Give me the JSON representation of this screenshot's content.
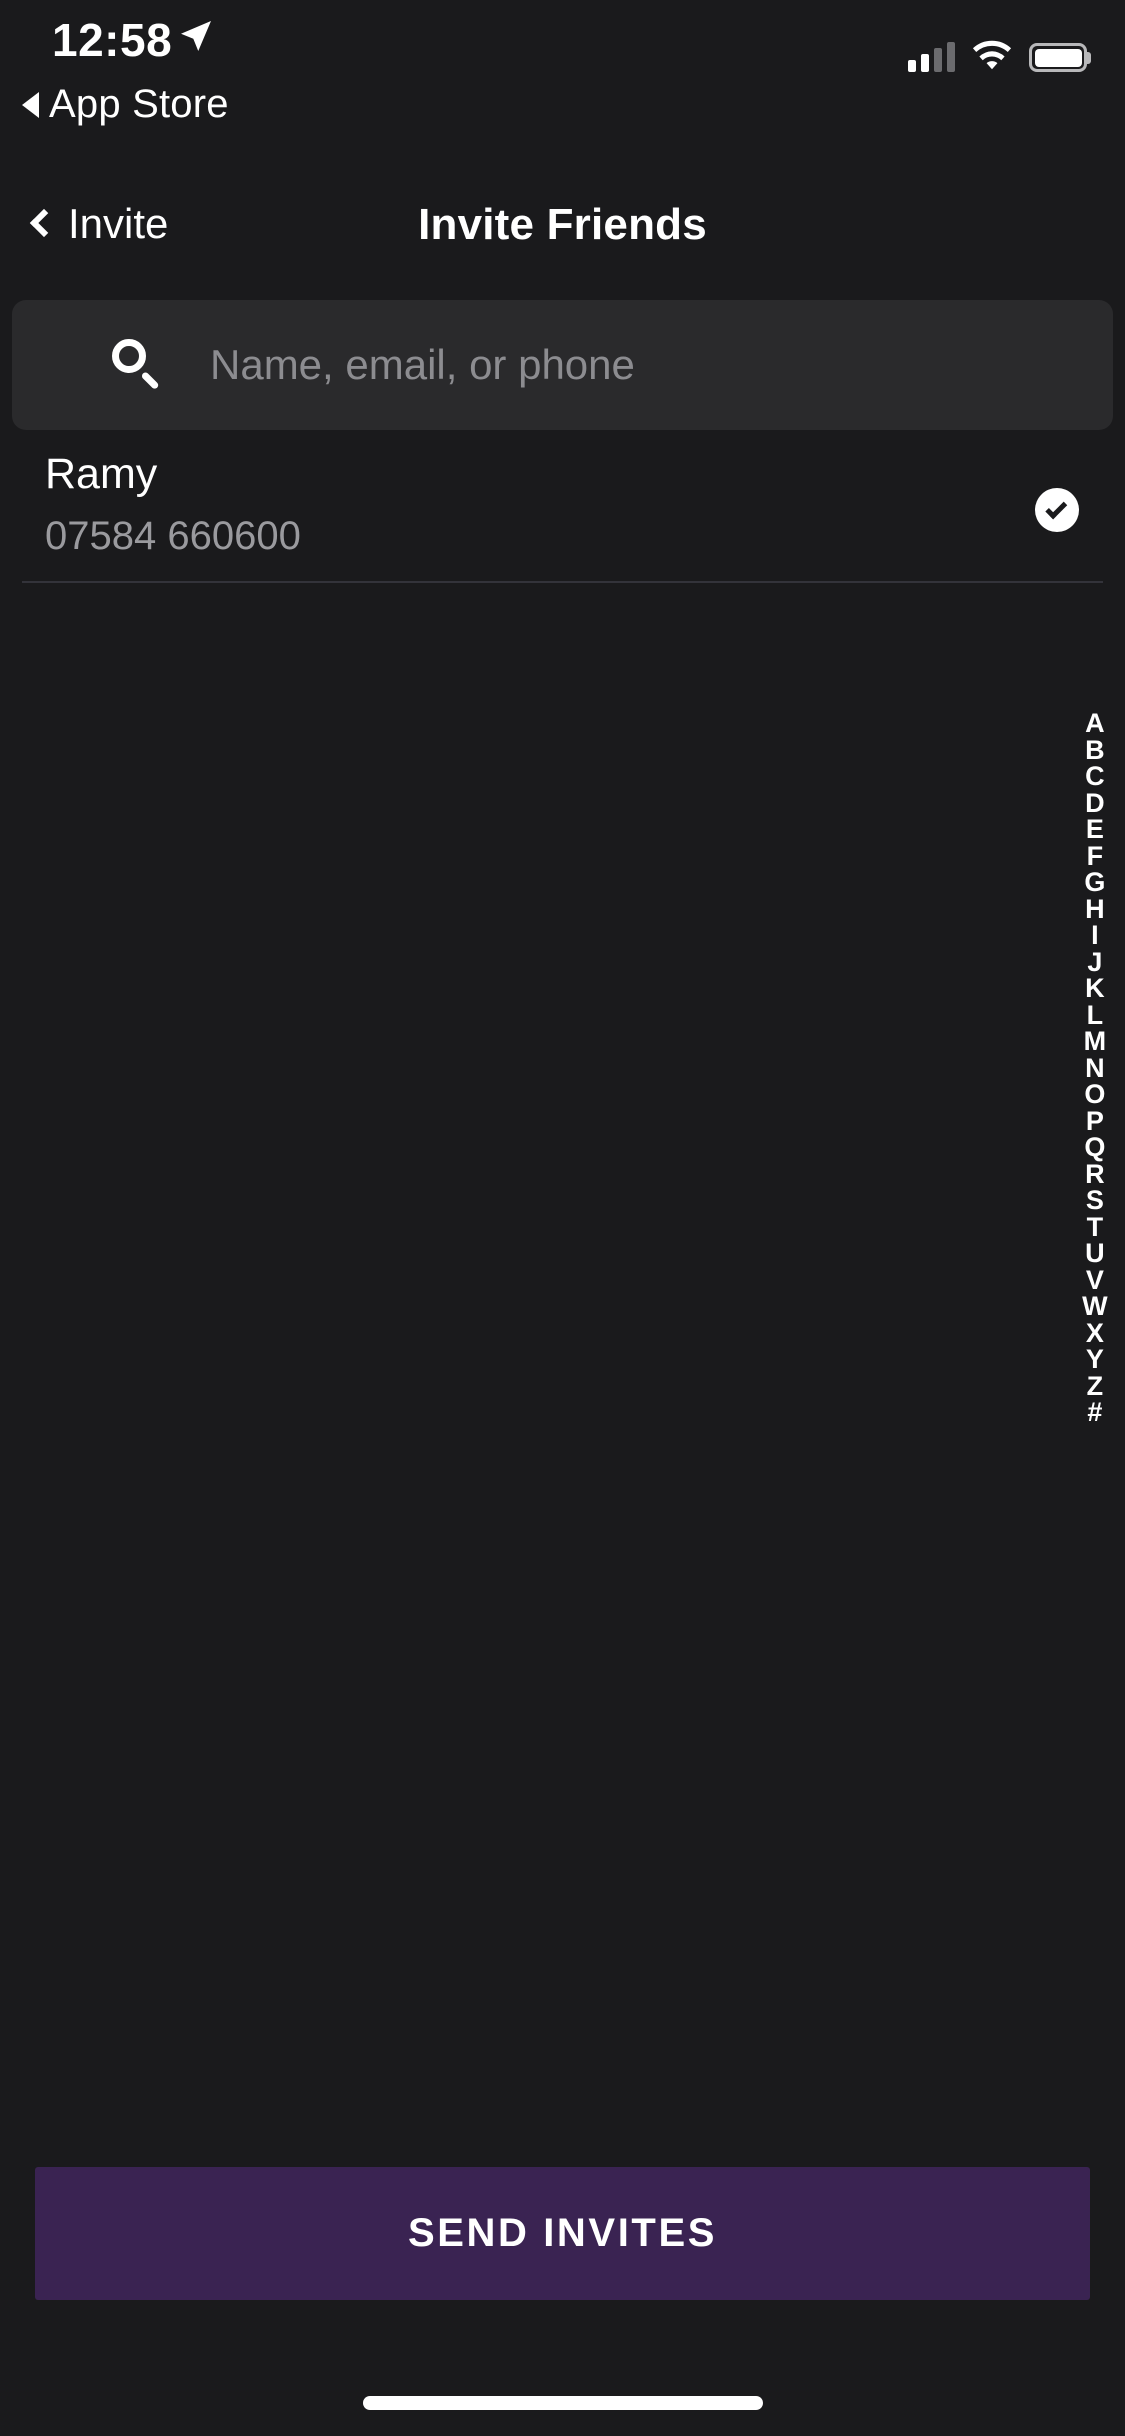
{
  "status_bar": {
    "time": "12:58",
    "location_icon": "location-arrow-icon",
    "back_to_app_label": "App Store",
    "back_to_app_icon": "triangle-left-icon",
    "signal_icon": "cellular-signal-icon",
    "signal_bars_active": 2,
    "signal_bars_total": 4,
    "wifi_icon": "wifi-icon",
    "battery_icon": "battery-full-icon"
  },
  "nav_bar": {
    "back_icon": "chevron-left-icon",
    "back_label": "Invite",
    "title": "Invite Friends"
  },
  "search": {
    "icon": "search-icon",
    "placeholder": "Name, email, or phone",
    "value": ""
  },
  "contacts": [
    {
      "name": "Ramy",
      "phone": "07584 660600",
      "selected": true,
      "select_icon": "check-circle-icon"
    }
  ],
  "alphabet_index": [
    "A",
    "B",
    "C",
    "D",
    "E",
    "F",
    "G",
    "H",
    "I",
    "J",
    "K",
    "L",
    "M",
    "N",
    "O",
    "P",
    "Q",
    "R",
    "S",
    "T",
    "U",
    "V",
    "W",
    "X",
    "Y",
    "Z",
    "#"
  ],
  "footer": {
    "send_button_label": "SEND INVITES"
  },
  "home_indicator": "home-indicator",
  "colors": {
    "background": "#1a1a1c",
    "search_field": "#2a2a2c",
    "accent_purple": "#3a2352",
    "primary_text": "#ffffff",
    "secondary_text": "#9a9a9e",
    "placeholder_text": "#8c8c90",
    "divider": "#33333a"
  }
}
